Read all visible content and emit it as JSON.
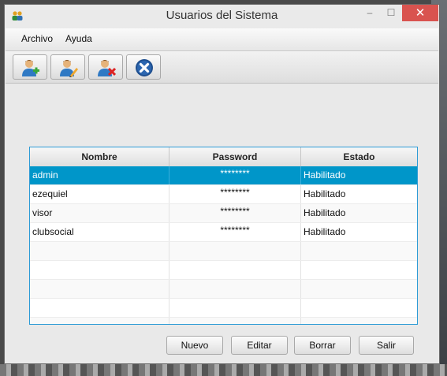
{
  "window": {
    "title": "Usuarios del Sistema",
    "minimize_glyph": "–",
    "maximize_glyph": "☐",
    "close_glyph": "✕"
  },
  "menu": [
    {
      "label": "Archivo"
    },
    {
      "label": "Ayuda"
    }
  ],
  "toolbar": [
    {
      "icon": "add-user-icon"
    },
    {
      "icon": "edit-user-icon"
    },
    {
      "icon": "delete-user-icon"
    },
    {
      "icon": "exit-icon"
    }
  ],
  "table": {
    "columns": [
      "Nombre",
      "Password",
      "Estado"
    ],
    "rows": [
      {
        "nombre": "admin",
        "password": "********",
        "estado": "Habilitado",
        "selected": true
      },
      {
        "nombre": "ezequiel",
        "password": "********",
        "estado": "Habilitado"
      },
      {
        "nombre": "visor",
        "password": "********",
        "estado": "Habilitado"
      },
      {
        "nombre": "clubsocial",
        "password": "********",
        "estado": "Habilitado"
      }
    ]
  },
  "buttons": {
    "nuevo": "Nuevo",
    "editar": "Editar",
    "borrar": "Borrar",
    "salir": "Salir"
  },
  "colors": {
    "selection": "#0096c9",
    "table_border": "#2d9bd6",
    "close_button": "#d9534f"
  }
}
